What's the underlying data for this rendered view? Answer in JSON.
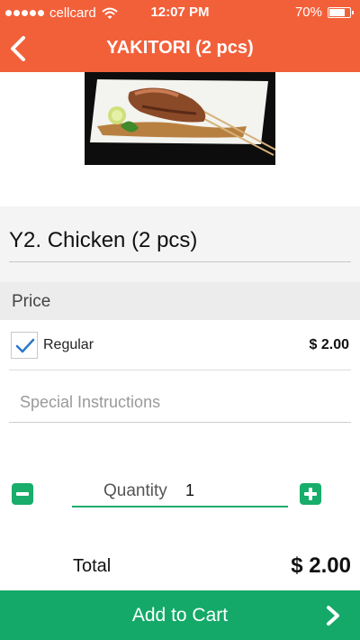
{
  "status_bar": {
    "carrier": "cellcard",
    "time": "12:07 PM",
    "battery": "70%",
    "battery_level": 0.7
  },
  "nav": {
    "title": "YAKITORI (2 pcs)",
    "back_icon": "chevron-left-icon"
  },
  "item": {
    "name": "Y2. Chicken (2 pcs)"
  },
  "price_section": {
    "label": "Price",
    "options": [
      {
        "name": "Regular",
        "price": "$ 2.00",
        "selected": true
      }
    ]
  },
  "instructions": {
    "placeholder": "Special Instructions",
    "value": ""
  },
  "quantity": {
    "label": "Quantity",
    "value": "1"
  },
  "total": {
    "label": "Total",
    "value": "$ 2.00"
  },
  "cart_button": {
    "label": "Add to Cart",
    "icon": "chevron-right-icon"
  },
  "colors": {
    "header": "#f2603a",
    "accent_green": "#14a968",
    "check_blue": "#2b78c9"
  }
}
